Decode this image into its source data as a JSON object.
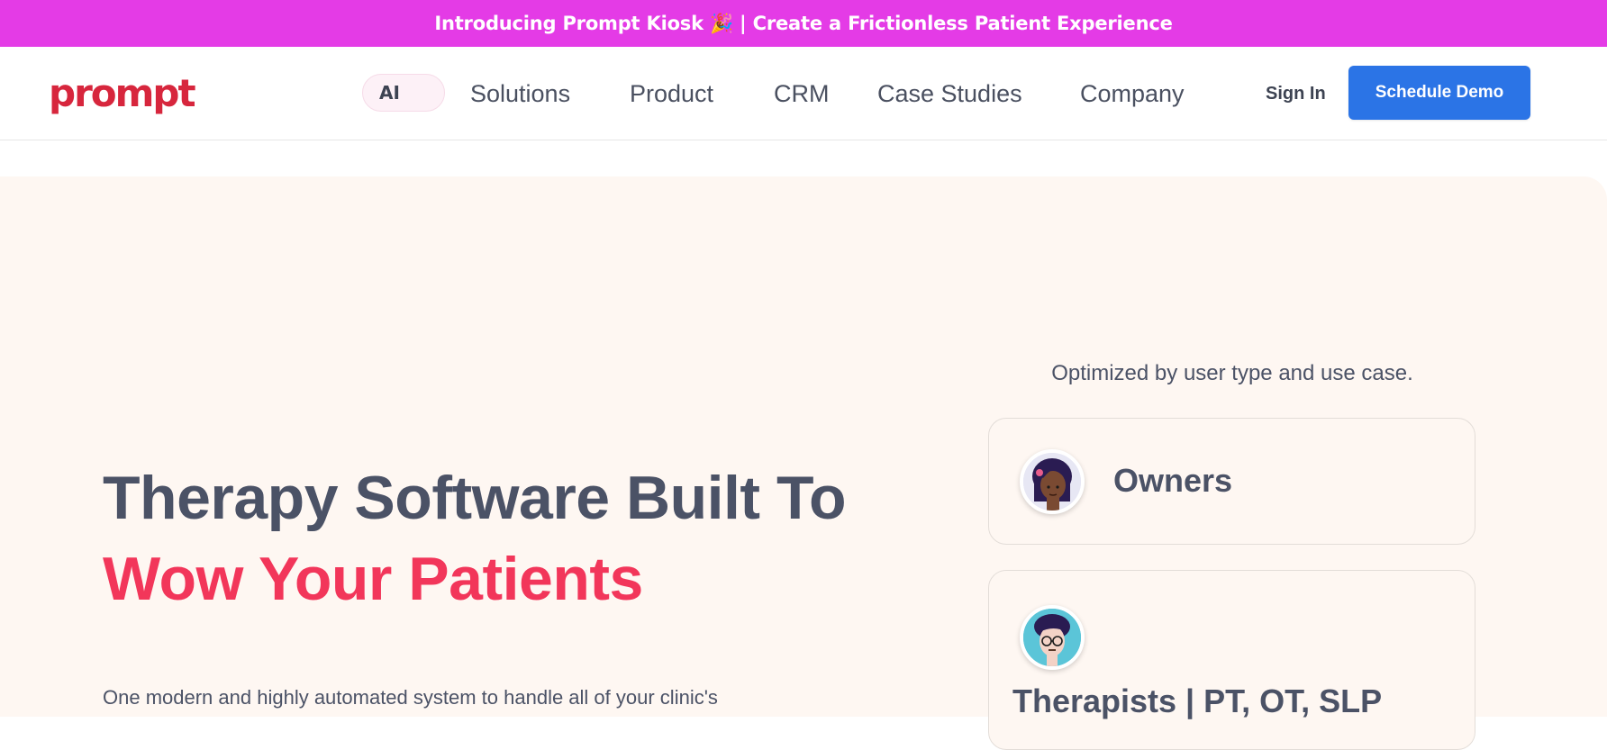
{
  "announcement": {
    "text": "Introducing Prompt Kiosk 🎉 | Create a Frictionless Patient Experience"
  },
  "header": {
    "logo_text": "prompt",
    "ai_label": "AI",
    "nav": [
      "Solutions",
      "Product",
      "CRM",
      "Case Studies",
      "Company"
    ],
    "sign_in": "Sign In",
    "demo_button": "Schedule Demo"
  },
  "hero": {
    "headline_line1": "Therapy Software Built To",
    "headline_line2": "Wow Your Patients",
    "description": "One modern and highly automated system to handle all of your clinic's"
  },
  "user_types": {
    "label": "Optimized by user type and use case.",
    "cards": [
      {
        "title": "Owners",
        "icon": "owner-avatar-icon"
      },
      {
        "title": "Therapists | PT, OT, SLP",
        "icon": "therapist-avatar-icon"
      }
    ]
  },
  "colors": {
    "announcement_bg": "#e43be6",
    "brand_red": "#d7263d",
    "headline_accent": "#f2365a",
    "button_blue": "#2b74e6",
    "hero_bg": "#fef7f2"
  }
}
